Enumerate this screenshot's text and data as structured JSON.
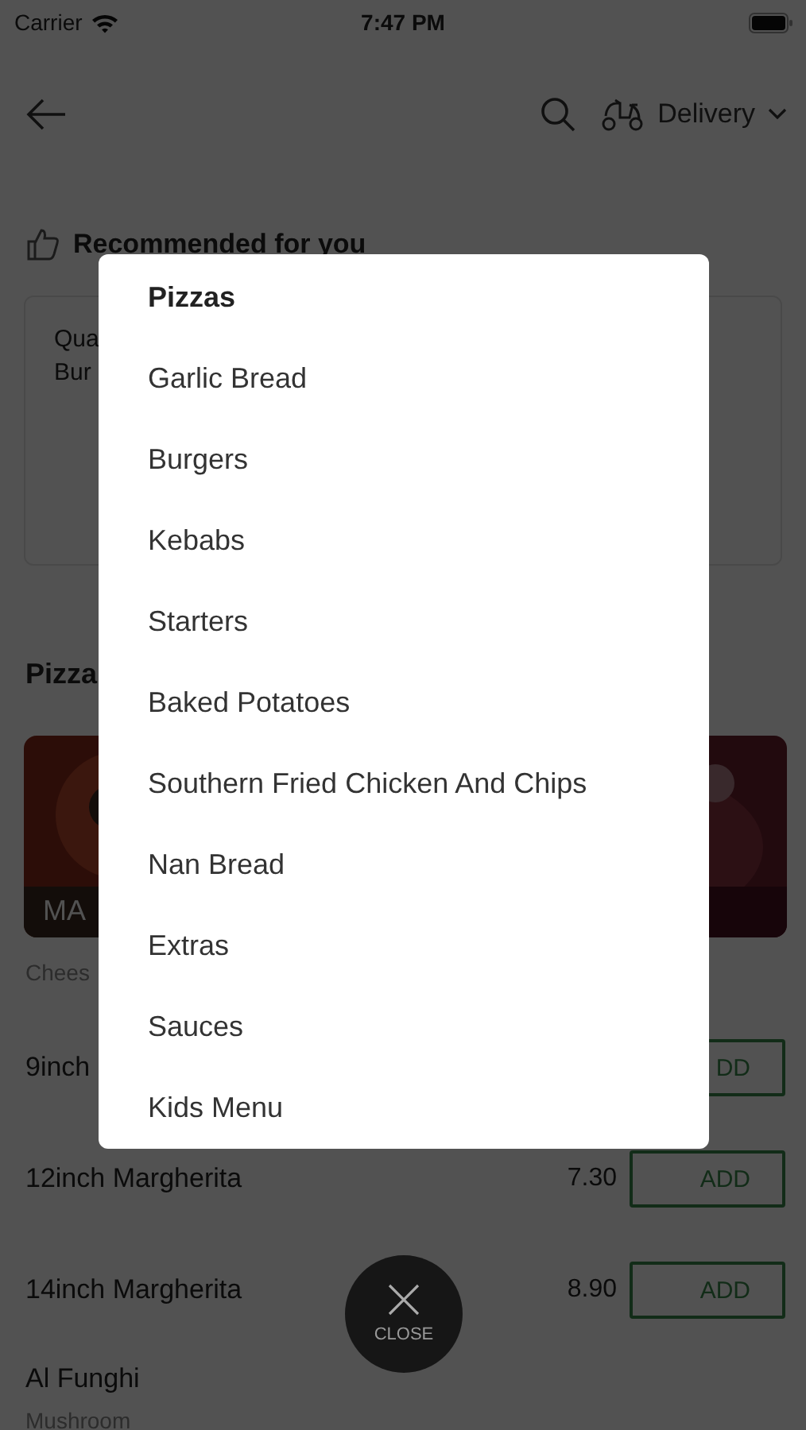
{
  "status_bar": {
    "carrier": "Carrier",
    "time": "7:47 PM"
  },
  "header": {
    "mode": "Delivery"
  },
  "recommended": {
    "title": "Recommended for you",
    "lines": [
      "Qua",
      "Bur"
    ]
  },
  "section": {
    "title": "Pizza",
    "cards": [
      {
        "kind": "picture",
        "label": "MA"
      },
      {
        "kind": "picture"
      }
    ]
  },
  "description": "Chees",
  "items": [
    {
      "name": "9inch",
      "button": "DD"
    },
    {
      "name": "12inch Margherita",
      "price": "7.30",
      "button": "ADD"
    },
    {
      "name": "14inch Margherita",
      "price": "8.90",
      "button": "ADD"
    }
  ],
  "next_item": {
    "name": "Al Funghi",
    "description": "Mushroom"
  },
  "menu": {
    "items": [
      {
        "label": "Pizzas",
        "selected": true
      },
      {
        "label": "Garlic Bread",
        "selected": false
      },
      {
        "label": "Burgers",
        "selected": false
      },
      {
        "label": "Kebabs",
        "selected": false
      },
      {
        "label": "Starters",
        "selected": false
      },
      {
        "label": "Baked Potatoes",
        "selected": false
      },
      {
        "label": "Southern Fried Chicken And Chips",
        "selected": false
      },
      {
        "label": "Nan Bread",
        "selected": false
      },
      {
        "label": "Extras",
        "selected": false
      },
      {
        "label": "Sauces",
        "selected": false
      },
      {
        "label": "Kids Menu",
        "selected": false
      }
    ]
  },
  "close_button": {
    "label": "CLOSE"
  }
}
